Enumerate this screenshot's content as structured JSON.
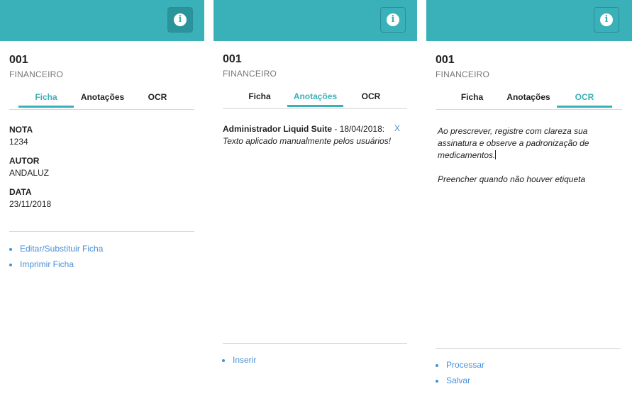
{
  "theme": {
    "teal": "#3ab0b8",
    "link_color": "#4a8fd6",
    "active_tab_color": "#3ab0b8"
  },
  "record": {
    "code": "001",
    "department": "FINANCEIRO"
  },
  "tabs": [
    "Ficha",
    "Anotações",
    "OCR"
  ],
  "info_icon": "info-circle-icon",
  "ficha": {
    "fields": [
      {
        "label": "NOTA",
        "value": "1234"
      },
      {
        "label": "AUTOR",
        "value": "ANDALUZ"
      },
      {
        "label": "DATA",
        "value": "23/11/2018"
      }
    ],
    "actions": [
      "Editar/Substituir Ficha",
      "Imprimir Ficha"
    ]
  },
  "anotacoes": {
    "items": [
      {
        "author": "Administrador Liquid Suite",
        "separator": " - ",
        "date": "18/04/2018:",
        "text": "Texto aplicado manualmente pelos usuários!",
        "remove_label": "X"
      }
    ],
    "actions": [
      "Inserir"
    ]
  },
  "ocr": {
    "paragraph1": "Ao prescrever, registre com clareza sua assinatura e observe a padronização de medicamentos.",
    "paragraph2": "Preencher quando não houver etiqueta",
    "actions": [
      "Processar",
      "Salvar"
    ]
  }
}
